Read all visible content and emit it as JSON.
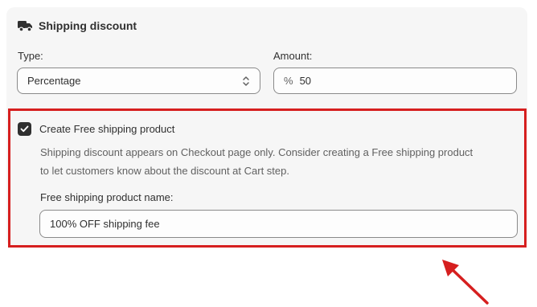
{
  "section": {
    "title": "Shipping discount",
    "icon": "truck-icon"
  },
  "type_field": {
    "label": "Type:",
    "value": "Percentage"
  },
  "amount_field": {
    "label": "Amount:",
    "prefix": "%",
    "value": "50"
  },
  "free_shipping": {
    "checkbox_label": "Create Free shipping product",
    "checked": true,
    "help_line1": "Shipping discount appears on Checkout page only. Consider creating a Free shipping product",
    "help_line2": "to let customers know about the discount at Cart step.",
    "name_label": "Free shipping product name:",
    "name_value": "100% OFF shipping fee"
  },
  "colors": {
    "highlight": "#d61f1f",
    "checkbox": "#303030"
  }
}
